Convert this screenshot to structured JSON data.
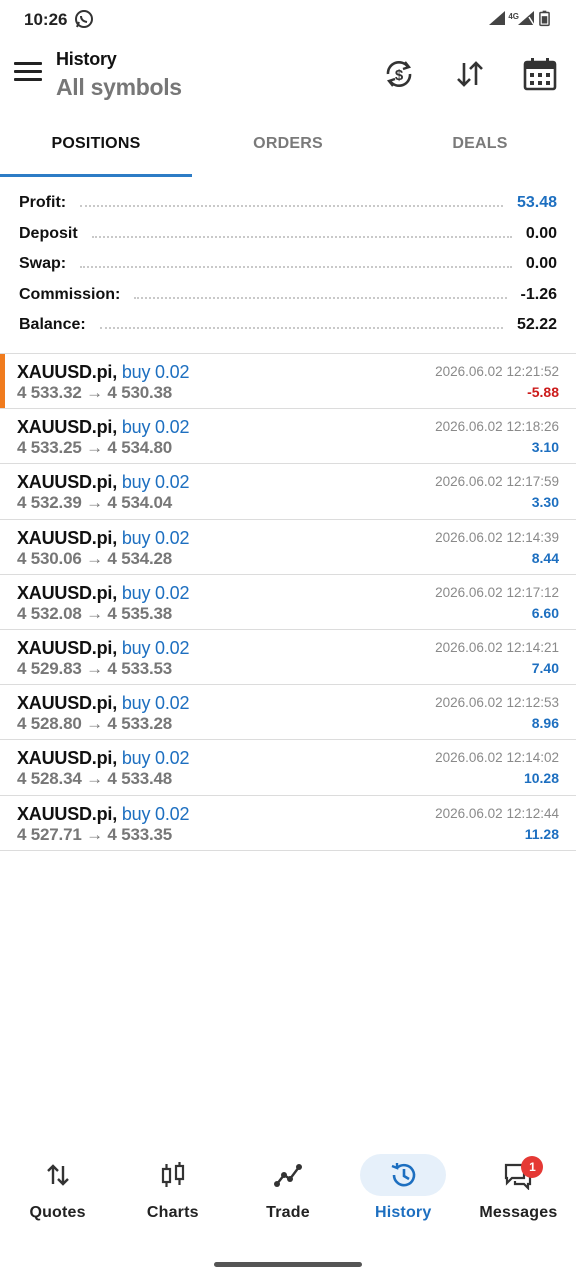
{
  "status_bar": {
    "time": "10:26",
    "network": "4G"
  },
  "toolbar": {
    "title": "History",
    "subtitle": "All symbols"
  },
  "tabs": [
    {
      "label": "POSITIONS",
      "active": true
    },
    {
      "label": "ORDERS",
      "active": false
    },
    {
      "label": "DEALS",
      "active": false
    }
  ],
  "summary": {
    "profit": {
      "label": "Profit:",
      "value": "53.48"
    },
    "deposit": {
      "label": "Deposit",
      "value": "0.00"
    },
    "swap": {
      "label": "Swap:",
      "value": "0.00"
    },
    "commission": {
      "label": "Commission:",
      "value": "-1.26"
    },
    "balance": {
      "label": "Balance:",
      "value": "52.22"
    }
  },
  "positions": [
    {
      "symbol": "XAUUSD.pi,",
      "side": "buy 0.02",
      "prices": "4 533.32 → 4 530.38",
      "time": "2026.06.02 12:21:52",
      "profit": "-5.88"
    },
    {
      "symbol": "XAUUSD.pi,",
      "side": "buy 0.02",
      "prices": "4 533.25 → 4 534.80",
      "time": "2026.06.02 12:18:26",
      "profit": "3.10"
    },
    {
      "symbol": "XAUUSD.pi,",
      "side": "buy 0.02",
      "prices": "4 532.39 → 4 534.04",
      "time": "2026.06.02 12:17:59",
      "profit": "3.30"
    },
    {
      "symbol": "XAUUSD.pi,",
      "side": "buy 0.02",
      "prices": "4 530.06 → 4 534.28",
      "time": "2026.06.02 12:14:39",
      "profit": "8.44"
    },
    {
      "symbol": "XAUUSD.pi,",
      "side": "buy 0.02",
      "prices": "4 532.08 → 4 535.38",
      "time": "2026.06.02 12:17:12",
      "profit": "6.60"
    },
    {
      "symbol": "XAUUSD.pi,",
      "side": "buy 0.02",
      "prices": "4 529.83 → 4 533.53",
      "time": "2026.06.02 12:14:21",
      "profit": "7.40"
    },
    {
      "symbol": "XAUUSD.pi,",
      "side": "buy 0.02",
      "prices": "4 528.80 → 4 533.28",
      "time": "2026.06.02 12:12:53",
      "profit": "8.96"
    },
    {
      "symbol": "XAUUSD.pi,",
      "side": "buy 0.02",
      "prices": "4 528.34 → 4 533.48",
      "time": "2026.06.02 12:14:02",
      "profit": "10.28"
    },
    {
      "symbol": "XAUUSD.pi,",
      "side": "buy 0.02",
      "prices": "4 527.71 → 4 533.35",
      "time": "2026.06.02 12:12:44",
      "profit": "11.28"
    }
  ],
  "bottom_nav": {
    "quotes": "Quotes",
    "charts": "Charts",
    "trade": "Trade",
    "history": "History",
    "messages": "Messages",
    "messages_badge": "1"
  },
  "colors": {
    "accent": "#1d6fc0",
    "negative": "#cc1b1b",
    "highlight": "#f07b1e",
    "tab_indicator": "#2d7cc6"
  },
  "icons": {
    "toolbar": [
      "menu-icon",
      "sync-currency-icon",
      "sort-icon",
      "calendar-icon"
    ],
    "nav": [
      "quotes-icon",
      "charts-icon",
      "trade-icon",
      "history-icon",
      "messages-icon"
    ]
  }
}
